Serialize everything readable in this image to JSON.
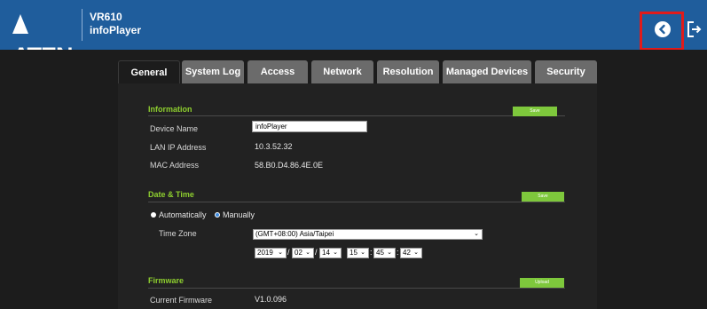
{
  "header": {
    "logo": "ATEN",
    "model": "VR610",
    "app": "infoPlayer"
  },
  "tabs": [
    {
      "label": "General",
      "active": true
    },
    {
      "label": "System Log",
      "active": false
    },
    {
      "label": "Access",
      "active": false
    },
    {
      "label": "Network",
      "active": false
    },
    {
      "label": "Resolution",
      "active": false
    },
    {
      "label": "Managed Devices",
      "active": false
    },
    {
      "label": "Security",
      "active": false
    }
  ],
  "information": {
    "title": "Information",
    "button": "Save",
    "device_name_label": "Device Name",
    "device_name_value": "infoPlayer",
    "lan_ip_label": "LAN IP Address",
    "lan_ip_value": "10.3.52.32",
    "mac_label": "MAC Address",
    "mac_value": "58.B0.D4.86.4E.0E"
  },
  "datetime": {
    "title": "Date & Time",
    "button": "Save",
    "auto_label": "Automatically",
    "manual_label": "Manually",
    "timezone_label": "Time Zone",
    "timezone_value": "(GMT+08:00) Asia/Taipei",
    "year": "2019",
    "month": "02",
    "day": "14",
    "hour": "15",
    "minute": "45",
    "second": "42"
  },
  "firmware": {
    "title": "Firmware",
    "button": "Upload",
    "current_label": "Current Firmware",
    "current_value": "V1.0.096"
  },
  "colors": {
    "header_blue": "#1f5d9c",
    "accent_green": "#7ec83c",
    "highlight_red": "#e01b1b"
  },
  "icons": [
    "back-icon",
    "logout-icon",
    "chevron-down-icon"
  ]
}
